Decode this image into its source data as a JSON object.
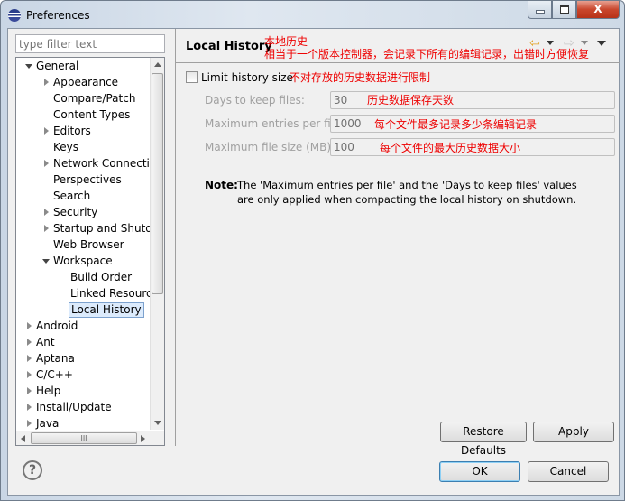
{
  "window": {
    "title": "Preferences",
    "minimize": "minimize",
    "maximize": "maximize",
    "close": "X"
  },
  "filter": {
    "placeholder": "type filter text"
  },
  "tree": [
    {
      "label": "General",
      "level": 0,
      "state": "expanded"
    },
    {
      "label": "Appearance",
      "level": 1,
      "state": "collapsed"
    },
    {
      "label": "Compare/Patch",
      "level": 1,
      "state": "leaf"
    },
    {
      "label": "Content Types",
      "level": 1,
      "state": "leaf"
    },
    {
      "label": "Editors",
      "level": 1,
      "state": "collapsed"
    },
    {
      "label": "Keys",
      "level": 1,
      "state": "leaf"
    },
    {
      "label": "Network Connections",
      "level": 1,
      "state": "collapsed"
    },
    {
      "label": "Perspectives",
      "level": 1,
      "state": "leaf"
    },
    {
      "label": "Search",
      "level": 1,
      "state": "leaf"
    },
    {
      "label": "Security",
      "level": 1,
      "state": "collapsed"
    },
    {
      "label": "Startup and Shutdown",
      "level": 1,
      "state": "collapsed"
    },
    {
      "label": "Web Browser",
      "level": 1,
      "state": "leaf"
    },
    {
      "label": "Workspace",
      "level": 1,
      "state": "expanded"
    },
    {
      "label": "Build Order",
      "level": 2,
      "state": "leaf"
    },
    {
      "label": "Linked Resources",
      "level": 2,
      "state": "leaf"
    },
    {
      "label": "Local History",
      "level": 2,
      "state": "leaf",
      "selected": true
    },
    {
      "label": "Android",
      "level": 0,
      "state": "collapsed"
    },
    {
      "label": "Ant",
      "level": 0,
      "state": "collapsed"
    },
    {
      "label": "Aptana",
      "level": 0,
      "state": "collapsed"
    },
    {
      "label": "C/C++",
      "level": 0,
      "state": "collapsed"
    },
    {
      "label": "Help",
      "level": 0,
      "state": "collapsed"
    },
    {
      "label": "Install/Update",
      "level": 0,
      "state": "collapsed"
    },
    {
      "label": "Java",
      "level": 0,
      "state": "collapsed"
    }
  ],
  "hscroll_grip": "III",
  "page": {
    "title": "Local History",
    "annotation_title": "本地历史",
    "annotation_desc": "相当于一个版本控制器，会记录下所有的编辑记录，出错时方便恢复",
    "limit_label": "Limit history size",
    "limit_checked": false,
    "limit_annotation": "不对存放的历史数据进行限制",
    "fields": [
      {
        "label": "Days to keep files:",
        "value": "30",
        "annotation": "历史数据保存天数"
      },
      {
        "label": "Maximum entries per file:",
        "value": "1000",
        "annotation": "每个文件最多记录多少条编辑记录"
      },
      {
        "label": "Maximum file size (MB):",
        "value": "100",
        "annotation": "每个文件的最大历史数据大小"
      }
    ],
    "note_label": "Note:",
    "note_line1": "The 'Maximum entries per file' and the 'Days to keep files' values",
    "note_line2": "are only applied when compacting the local history on shutdown.",
    "restore_defaults": "Restore Defaults",
    "apply": "Apply"
  },
  "footer": {
    "help": "?",
    "ok": "OK",
    "cancel": "Cancel"
  },
  "colors": {
    "annotation": "#ee0000",
    "selection": "#dcebfc",
    "close_button": "#c9462c"
  }
}
